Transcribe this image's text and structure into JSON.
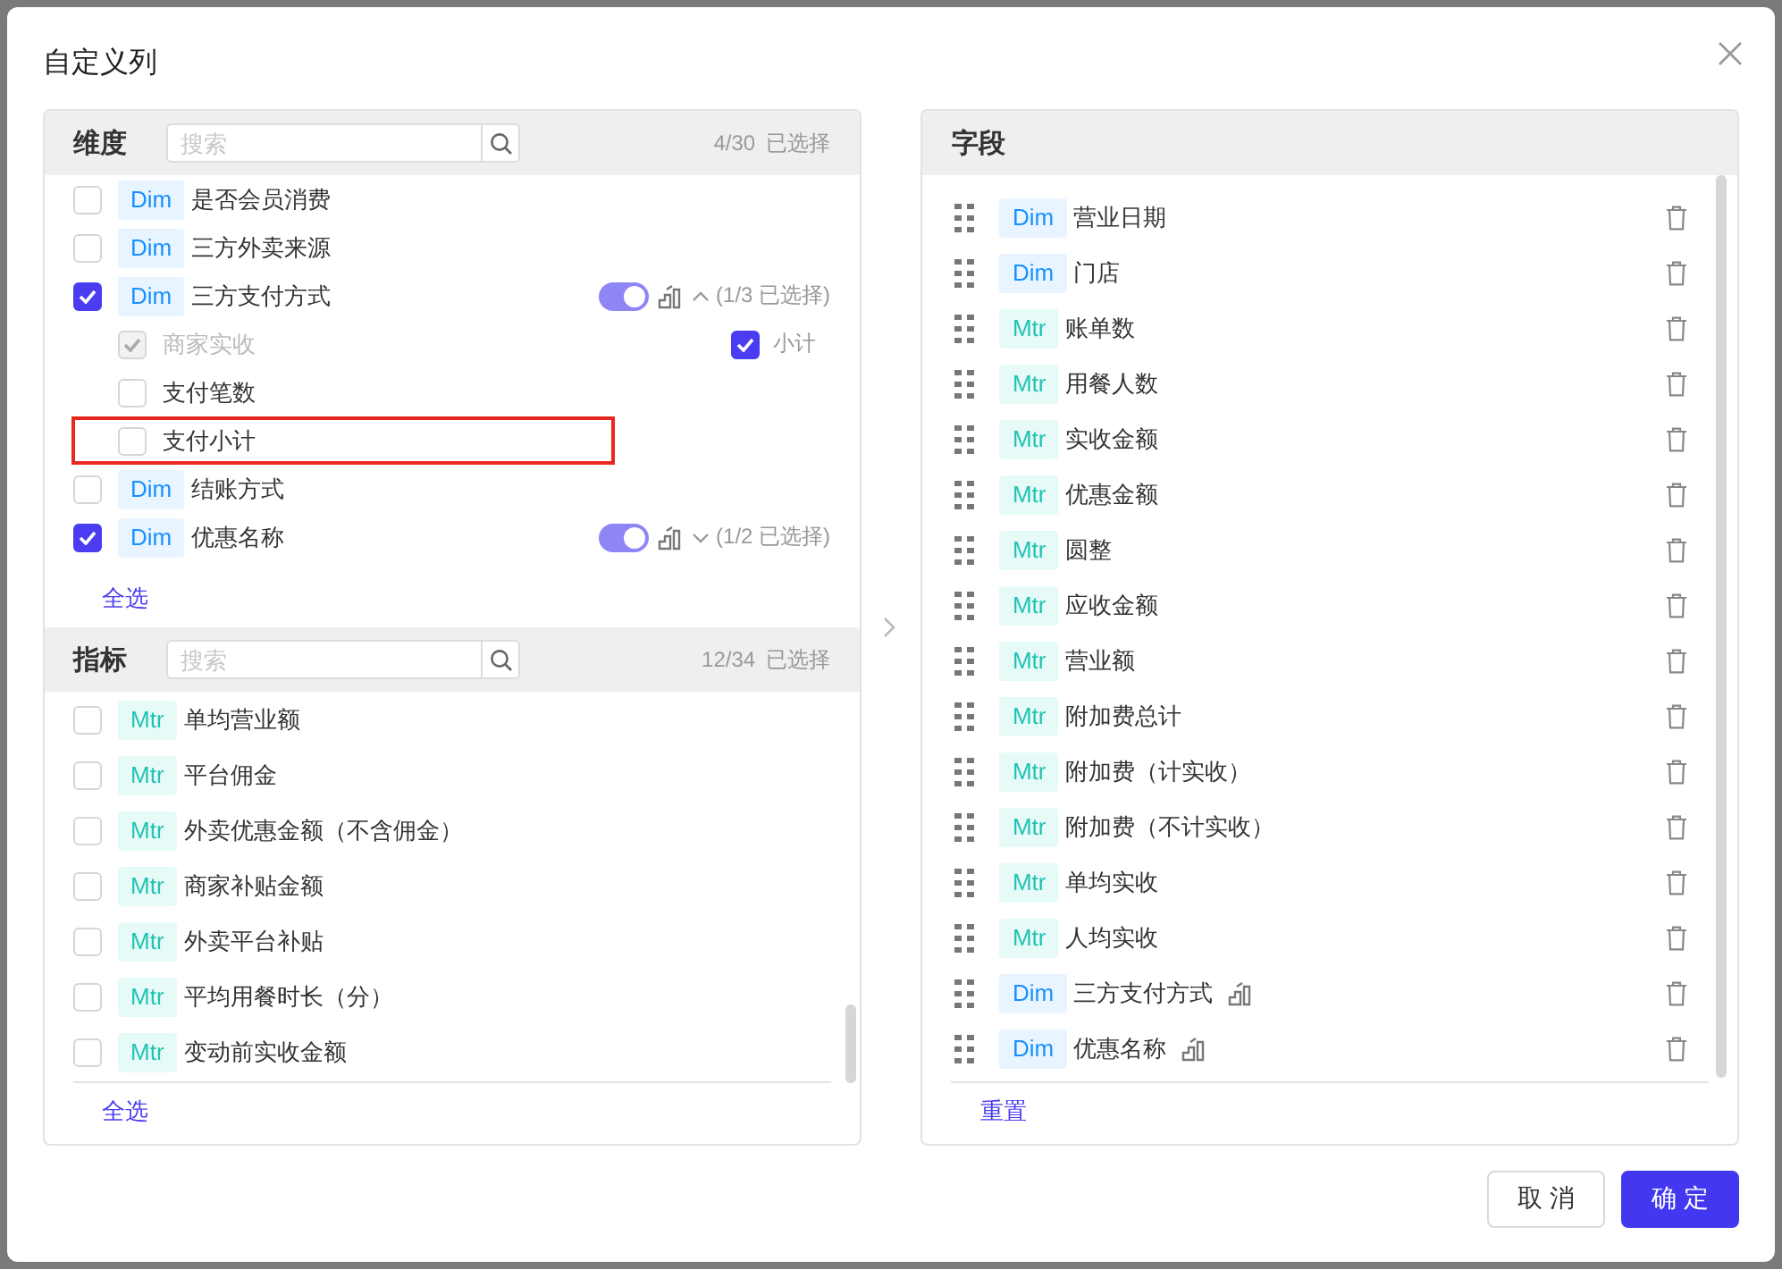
{
  "dialog": {
    "title": "自定义列"
  },
  "dimensions": {
    "title": "维度",
    "search": {
      "placeholder": "搜索"
    },
    "count": "4/30",
    "count_label": "已选择",
    "select_all": "全选",
    "items": [
      {
        "kind": "dim",
        "tag": "Dim",
        "label": "是否会员消费",
        "checked": false
      },
      {
        "kind": "dim",
        "tag": "Dim",
        "label": "三方外卖来源",
        "checked": false
      },
      {
        "kind": "dim",
        "tag": "Dim",
        "label": "三方支付方式",
        "checked": true,
        "group": {
          "toggle_on": true,
          "expanded": true,
          "summary": "(1/3 已选择)",
          "children": [
            {
              "label": "商家实收",
              "checked": true,
              "disabled": true,
              "highlighted": false,
              "subtotal": {
                "label": "小计",
                "checked": true
              }
            },
            {
              "label": "支付笔数",
              "checked": false,
              "disabled": false,
              "highlighted": false
            },
            {
              "label": "支付小计",
              "checked": false,
              "disabled": false,
              "highlighted": true
            }
          ]
        }
      },
      {
        "kind": "dim",
        "tag": "Dim",
        "label": "结账方式",
        "checked": false
      },
      {
        "kind": "dim",
        "tag": "Dim",
        "label": "优惠名称",
        "checked": true,
        "group": {
          "toggle_on": true,
          "expanded": false,
          "summary": "(1/2 已选择)"
        }
      }
    ]
  },
  "metrics": {
    "title": "指标",
    "search": {
      "placeholder": "搜索"
    },
    "count": "12/34",
    "count_label": "已选择",
    "select_all": "全选",
    "items": [
      {
        "kind": "mtr",
        "tag": "Mtr",
        "label": "单均营业额",
        "checked": false
      },
      {
        "kind": "mtr",
        "tag": "Mtr",
        "label": "平台佣金",
        "checked": false
      },
      {
        "kind": "mtr",
        "tag": "Mtr",
        "label": "外卖优惠金额（不含佣金）",
        "checked": false
      },
      {
        "kind": "mtr",
        "tag": "Mtr",
        "label": "商家补贴金额",
        "checked": false
      },
      {
        "kind": "mtr",
        "tag": "Mtr",
        "label": "外卖平台补贴",
        "checked": false
      },
      {
        "kind": "mtr",
        "tag": "Mtr",
        "label": "平均用餐时长（分）",
        "checked": false
      },
      {
        "kind": "mtr",
        "tag": "Mtr",
        "label": "变动前实收金额",
        "checked": false
      }
    ]
  },
  "fields": {
    "title": "字段",
    "reset": "重置",
    "items": [
      {
        "kind": "dim",
        "tag": "Dim",
        "label": "营业日期",
        "grouped": false
      },
      {
        "kind": "dim",
        "tag": "Dim",
        "label": "门店",
        "grouped": false
      },
      {
        "kind": "mtr",
        "tag": "Mtr",
        "label": "账单数",
        "grouped": false
      },
      {
        "kind": "mtr",
        "tag": "Mtr",
        "label": "用餐人数",
        "grouped": false
      },
      {
        "kind": "mtr",
        "tag": "Mtr",
        "label": "实收金额",
        "grouped": false
      },
      {
        "kind": "mtr",
        "tag": "Mtr",
        "label": "优惠金额",
        "grouped": false
      },
      {
        "kind": "mtr",
        "tag": "Mtr",
        "label": "圆整",
        "grouped": false
      },
      {
        "kind": "mtr",
        "tag": "Mtr",
        "label": "应收金额",
        "grouped": false
      },
      {
        "kind": "mtr",
        "tag": "Mtr",
        "label": "营业额",
        "grouped": false
      },
      {
        "kind": "mtr",
        "tag": "Mtr",
        "label": "附加费总计",
        "grouped": false
      },
      {
        "kind": "mtr",
        "tag": "Mtr",
        "label": "附加费（计实收）",
        "grouped": false
      },
      {
        "kind": "mtr",
        "tag": "Mtr",
        "label": "附加费（不计实收）",
        "grouped": false
      },
      {
        "kind": "mtr",
        "tag": "Mtr",
        "label": "单均实收",
        "grouped": false
      },
      {
        "kind": "mtr",
        "tag": "Mtr",
        "label": "人均实收",
        "grouped": false
      },
      {
        "kind": "dim",
        "tag": "Dim",
        "label": "三方支付方式",
        "grouped": true
      },
      {
        "kind": "dim",
        "tag": "Dim",
        "label": "优惠名称",
        "grouped": true
      }
    ]
  },
  "buttons": [
    {
      "kind": "secondary",
      "label": "取 消"
    },
    {
      "kind": "primary",
      "label": "确 定"
    }
  ]
}
